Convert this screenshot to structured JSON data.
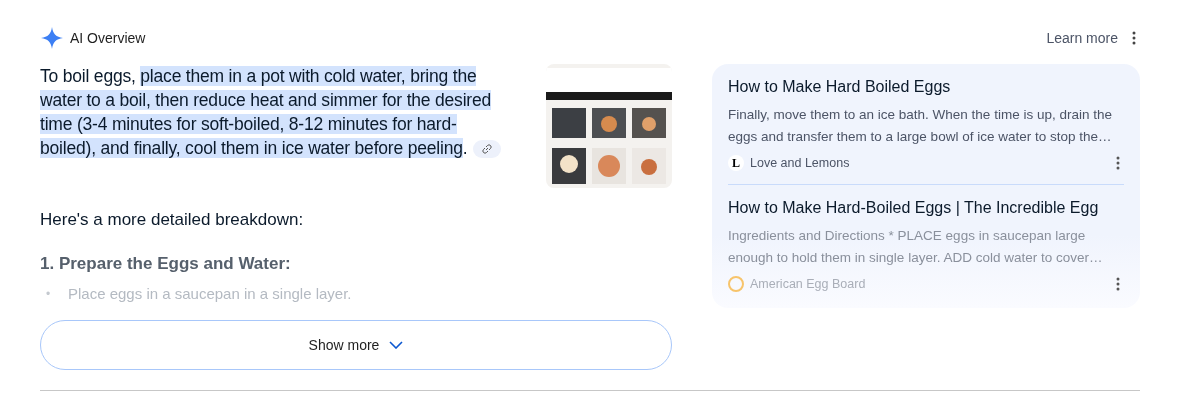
{
  "header": {
    "title": "AI Overview",
    "learn_more": "Learn more"
  },
  "answer": {
    "lead": "To boil eggs, ",
    "highlighted": "place them in a pot with cold water, bring the water to a boil, then reduce heat and simmer for the desired time (3-4 minutes for soft-boiled, 8-12 minutes for hard-boiled), and finally, cool them in ice water before peeling",
    "tail": "."
  },
  "intro": "Here's a more detailed breakdown:",
  "step_heading": "1. Prepare the Eggs and Water:",
  "bullets": [
    {
      "marker": "•",
      "text": "Place eggs in a saucepan in a single layer."
    }
  ],
  "show_more": "Show more",
  "sources": [
    {
      "title": "How to Make Hard Boiled Eggs",
      "snippet": "Finally, move them to an ice bath. When the time is up, drain the eggs and transfer them to a large bowl of ice water to stop the…",
      "publisher": "Love and Lemons",
      "logo": "L"
    },
    {
      "title": "How to Make Hard-Boiled Eggs | The Incredible Egg",
      "snippet": "Ingredients and Directions * PLACE eggs in saucepan large enough to hold them in single layer. ADD cold water to cover…",
      "publisher": "American Egg Board"
    }
  ]
}
